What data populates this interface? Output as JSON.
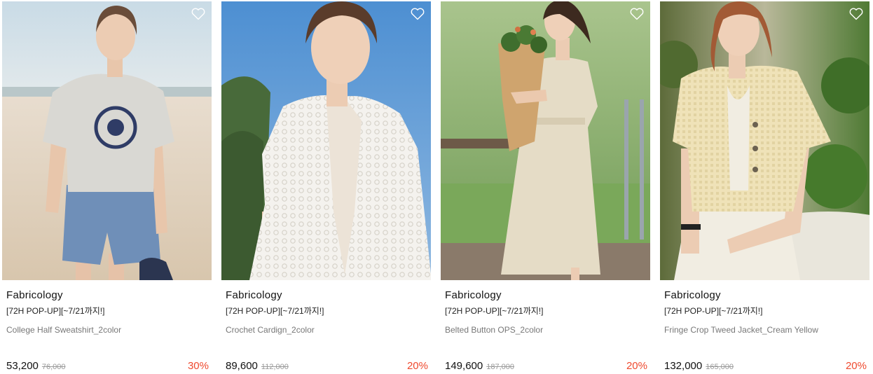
{
  "accent": {
    "discount": "#ef4a2f",
    "wish": "#ffffff"
  },
  "products": [
    {
      "image": "woman in grey college sweatshirt and denim shorts on a beach",
      "wish_icon": "heart-outline-icon",
      "brand": "Fabricology",
      "promo": "[72H POP-UP][~7/21까지!]",
      "name": "College Half Sweatshirt_2color",
      "price": "53,200",
      "original_price": "76,000",
      "discount": "30%"
    },
    {
      "image": "woman in white crochet cardigan against blue sky",
      "wish_icon": "heart-outline-icon",
      "brand": "Fabricology",
      "promo": "[72H POP-UP][~7/21까지!]",
      "name": "Crochet Cardign_2color",
      "price": "89,600",
      "original_price": "112,000",
      "discount": "20%"
    },
    {
      "image": "woman in beige belted button dress holding a flower bouquet",
      "wish_icon": "heart-outline-icon",
      "brand": "Fabricology",
      "promo": "[72H POP-UP][~7/21까지!]",
      "name": "Belted Button OPS_2color",
      "price": "149,600",
      "original_price": "187,000",
      "discount": "20%"
    },
    {
      "image": "woman in cream yellow tweed crop jacket seated among plants",
      "wish_icon": "heart-outline-icon",
      "brand": "Fabricology",
      "promo": "[72H POP-UP][~7/21까지!]",
      "name": "Fringe Crop Tweed Jacket_Cream Yellow",
      "price": "132,000",
      "original_price": "165,000",
      "discount": "20%"
    }
  ]
}
